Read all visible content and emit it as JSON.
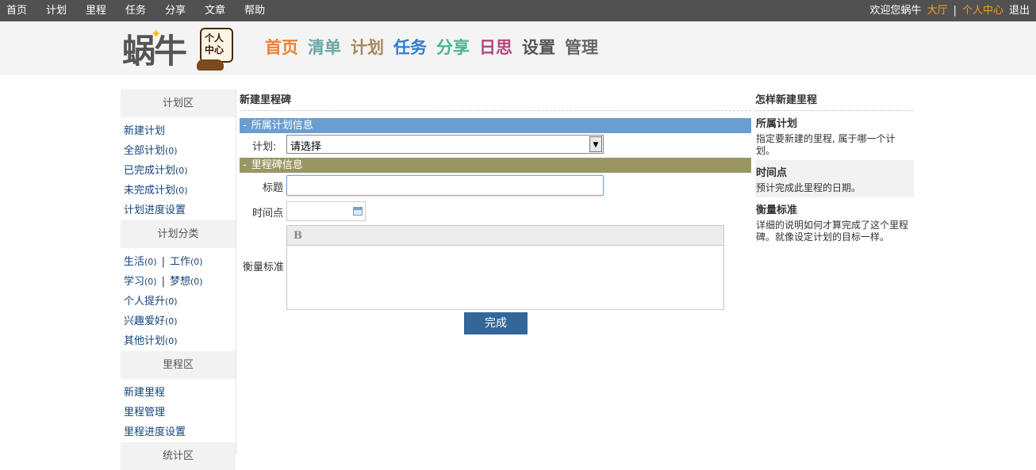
{
  "topbar": {
    "nav": [
      "首页",
      "计划",
      "里程",
      "任务",
      "分享",
      "文章",
      "帮助"
    ],
    "welcome": "欢迎您蜗牛",
    "hall": "大厅",
    "separator": "|",
    "personal_center": "个人中心",
    "logout": "退出"
  },
  "header": {
    "logo_text": "蜗牛",
    "badge_line1": "个人",
    "badge_line2": "中心",
    "nav": [
      {
        "label": "首页",
        "color": "#ee7f2c"
      },
      {
        "label": "清单",
        "color": "#6aa8a6"
      },
      {
        "label": "计划",
        "color": "#a8875c"
      },
      {
        "label": "任务",
        "color": "#2a7fd6"
      },
      {
        "label": "分享",
        "color": "#4bb493"
      },
      {
        "label": "日思",
        "color": "#b3477f"
      },
      {
        "label": "设置",
        "color": "#555555"
      },
      {
        "label": "管理",
        "color": "#666666"
      }
    ]
  },
  "sidebar": {
    "plan_section": "计划区",
    "new_plan": "新建计划",
    "all_plans": "全部计划",
    "all_plans_count": "(0)",
    "completed_plans": "已完成计划",
    "completed_count": "(0)",
    "incomplete_plans": "未完成计划",
    "incomplete_count": "(0)",
    "plan_progress_settings": "计划进度设置",
    "category_section": "计划分类",
    "life": "生活",
    "life_count": "(0)",
    "work": "工作",
    "work_count": "(0)",
    "study": "学习",
    "study_count": "(0)",
    "dream": "梦想",
    "dream_count": "(0)",
    "pair_sep": "|",
    "self_improve": "个人提升",
    "self_improve_count": "(0)",
    "hobbies": "兴趣爱好",
    "hobbies_count": "(0)",
    "other_plans": "其他计划",
    "other_count": "(0)",
    "milestone_section": "里程区",
    "new_milestone": "新建里程",
    "milestone_manage": "里程管理",
    "milestone_progress_settings": "里程进度设置",
    "stats_section": "统计区"
  },
  "main": {
    "title": "新建里程碑",
    "section1": "所属计划信息",
    "minus": "-",
    "plan_label": "计划:",
    "plan_value": "请选择",
    "section2": "里程碑信息",
    "title_label": "标题",
    "title_value": "",
    "time_label": "时间点",
    "criteria_label": "衡量标准",
    "bold_tool": "B",
    "submit": "完成"
  },
  "help": {
    "title": "怎样新建里程",
    "h1": "所属计划",
    "p1": "指定要新建的里程, 属于哪一个计划。",
    "h2": "时间点",
    "p2": "预计完成此里程的日期。",
    "h3": "衡量标准",
    "p3": "详细的说明如何才算完成了这个里程碑。就像设定计划的目标一样。"
  }
}
